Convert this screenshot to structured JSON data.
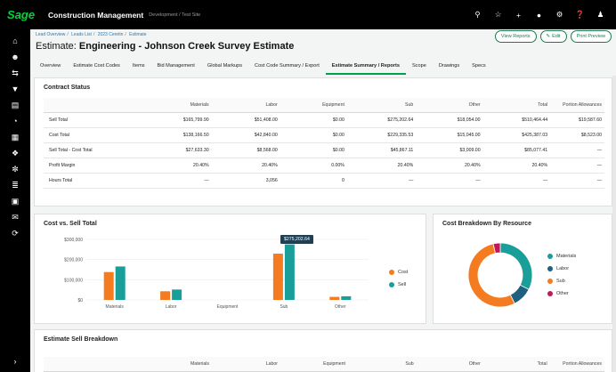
{
  "topbar": {
    "logo": "Sage",
    "app_title": "Construction Management",
    "environment": "Development / Test Site",
    "icons": [
      "search-icon",
      "star-icon",
      "plus-icon",
      "bell-icon",
      "gear-icon",
      "help-icon",
      "user-icon"
    ]
  },
  "leftnav": {
    "icons": [
      "home-icon",
      "people-icon",
      "switch-icon",
      "filter-icon",
      "calendar-icon",
      "pie-icon",
      "grid-icon",
      "leaf-icon",
      "run-icon",
      "tool-icon",
      "document-icon",
      "mail-icon",
      "refresh-icon",
      "expand-icon"
    ]
  },
  "breadcrumb": [
    "Lead Overview",
    "Leads List",
    "2023 Ceretin",
    "Estimate"
  ],
  "page": {
    "title_prefix": "Estimate: ",
    "title_main": "Engineering - Johnson Creek Survey Estimate"
  },
  "buttons": {
    "view_reports": "View Reports",
    "edit": "Edit",
    "print_preview": "Print Preview"
  },
  "tabs": [
    {
      "label": "Overview",
      "active": false
    },
    {
      "label": "Estimate Cost Codes",
      "active": false
    },
    {
      "label": "Items",
      "active": false
    },
    {
      "label": "Bid Management",
      "active": false
    },
    {
      "label": "Global Markups",
      "active": false
    },
    {
      "label": "Cost Code Summary / Export",
      "active": false
    },
    {
      "label": "Estimate Summary / Reports",
      "active": true
    },
    {
      "label": "Scope",
      "active": false
    },
    {
      "label": "Drawings",
      "active": false
    },
    {
      "label": "Specs",
      "active": false
    }
  ],
  "contract_status": {
    "title": "Contract Status",
    "columns": [
      "",
      "Materials",
      "Labor",
      "Equipment",
      "Sub",
      "Other",
      "Total",
      "Portion Allowances"
    ],
    "rows": [
      [
        "Sell Total",
        "$165,799.90",
        "$51,408.00",
        "$0.00",
        "$275,202.64",
        "$18,054.00",
        "$510,464.44",
        "$19,587.60"
      ],
      [
        "Cost Total",
        "$138,166.50",
        "$42,840.00",
        "$0.00",
        "$229,335.53",
        "$15,045.00",
        "$425,387.03",
        "$8,523.00"
      ],
      [
        "Sell Total - Cost Total",
        "$27,633.30",
        "$8,568.00",
        "$0.00",
        "$45,867.11",
        "$3,009.00",
        "$85,077.41",
        "—"
      ],
      [
        "Profit Margin",
        "20.40%",
        "20.40%",
        "0.00%",
        "20.40%",
        "20.40%",
        "20.40%",
        "—"
      ],
      [
        "Hours Total",
        "—",
        "3,056",
        "0",
        "—",
        "—",
        "—",
        "—"
      ]
    ]
  },
  "cost_vs_sell": {
    "title": "Cost vs. Sell Total",
    "tooltip": "$275,202.64",
    "legend": [
      {
        "label": "Cost",
        "color": "#f47b20"
      },
      {
        "label": "Sell",
        "color": "#1a9e9a"
      }
    ]
  },
  "cost_breakdown": {
    "title": "Cost Breakdown By Resource",
    "legend": [
      {
        "label": "Materials",
        "color": "#1a9e9a"
      },
      {
        "label": "Labor",
        "color": "#1f5f80"
      },
      {
        "label": "Sub",
        "color": "#f47b20"
      },
      {
        "label": "Other",
        "color": "#c2185b"
      }
    ]
  },
  "sell_breakdown": {
    "title": "Estimate Sell Breakdown",
    "columns": [
      "",
      "Materials",
      "Labor",
      "Equipment",
      "Sub",
      "Other",
      "Total",
      "Portion Allowances"
    ]
  },
  "chart_data": [
    {
      "type": "bar",
      "title": "Cost vs. Sell Total",
      "categories": [
        "Materials",
        "Labor",
        "Equipment",
        "Sub",
        "Other"
      ],
      "series": [
        {
          "name": "Cost",
          "values": [
            138166.5,
            42840,
            0,
            229335.53,
            15045
          ],
          "color": "#f47b20"
        },
        {
          "name": "Sell",
          "values": [
            165799.9,
            51408,
            0,
            275202.64,
            18054
          ],
          "color": "#1a9e9a"
        }
      ],
      "y_ticks": [
        "$0",
        "$100,000",
        "$200,000",
        "$300,000"
      ],
      "ylim": [
        0,
        300000
      ],
      "legend": "right"
    },
    {
      "type": "pie",
      "title": "Cost Breakdown By Resource",
      "categories": [
        "Materials",
        "Labor",
        "Sub",
        "Other"
      ],
      "values": [
        138166.5,
        42840,
        229335.53,
        15045
      ],
      "colors": [
        "#1a9e9a",
        "#1f5f80",
        "#f47b20",
        "#c2185b"
      ],
      "legend": "right"
    }
  ]
}
